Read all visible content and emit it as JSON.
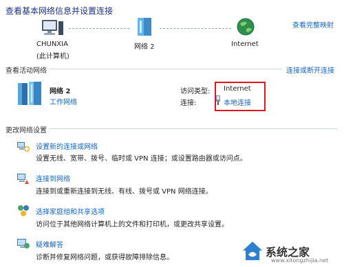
{
  "header": {
    "title": "查看基本网络信息并设置连接",
    "full_map_link": "查看完整映射"
  },
  "map": {
    "computer_name": "CHUNXIA",
    "computer_sub": "(此计算机)",
    "network_name": "网络  2",
    "internet_label": "Internet"
  },
  "active": {
    "section_label": "查看活动网络",
    "connect_link": "连接或断开连接",
    "network_name": "网络  2",
    "network_type": "工作网络",
    "access_type_label": "访问类型:",
    "access_type_value": "Internet",
    "connection_label": "连接:",
    "connection_value": "本地连接"
  },
  "change": {
    "section_label": "更改网络设置",
    "items": [
      {
        "title": "设置新的连接或网络",
        "desc": "设置无线、宽带、拨号、临时或 VPN 连接；或设置路由器或访问点。"
      },
      {
        "title": "连接到网络",
        "desc": "连接到或重新连接到无线、有线、拨号或 VPN 网络连接。"
      },
      {
        "title": "选择家庭组和共享选项",
        "desc": "访问位于其他网络计算机上的文件和打印机，或更改共享设置。"
      },
      {
        "title": "疑难解答",
        "desc": "诊断并修复网络问题，或获得故障排除信息。"
      }
    ]
  },
  "watermark": {
    "brand": "系统之家",
    "url": "www.xitongzhijia.net"
  }
}
